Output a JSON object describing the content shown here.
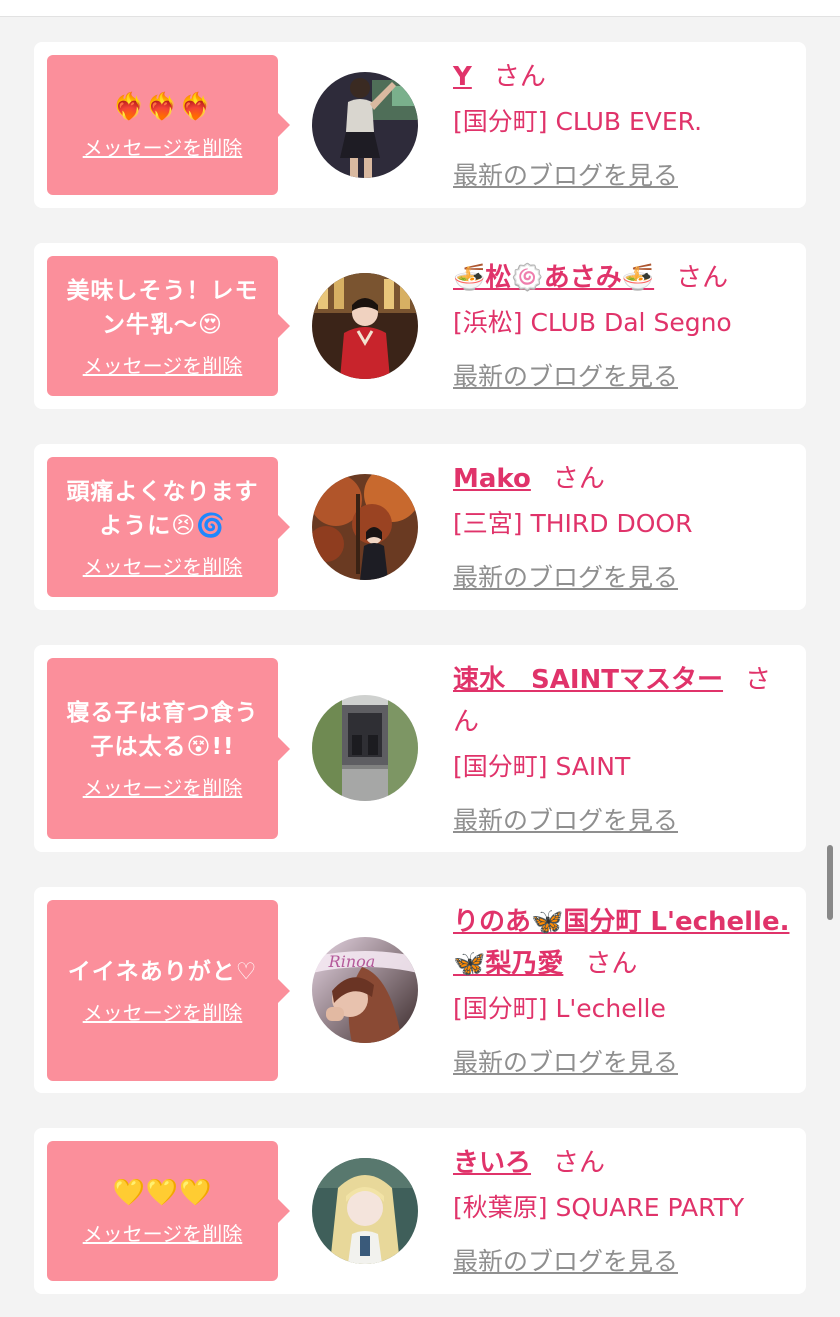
{
  "delete_label": "メッセージを削除",
  "san_label": "さん",
  "blog_label": "最新のブログを見る",
  "colors": {
    "bubble": "#fb8f9b",
    "accent": "#e0336a",
    "muted_link": "#8f8f8f",
    "background": "#f3f3f3"
  },
  "cards": [
    {
      "message": "❤️‍🔥❤️‍🔥❤️‍🔥",
      "name": "Y",
      "shop": "[国分町] CLUB EVER.",
      "avatar": "avatar-photo-dancer"
    },
    {
      "message": "美味しそう！レモン牛乳〜😍",
      "name": "🍜松🍥あさみ🍜",
      "shop": "[浜松] CLUB Dal Segno",
      "avatar": "avatar-photo-kimono"
    },
    {
      "message": "頭痛よくなりますように😣🌀",
      "name": "Mako",
      "shop": "[三宮] THIRD DOOR",
      "avatar": "avatar-photo-autumn"
    },
    {
      "message": "寝る子は育つ食う子は太る😵!!",
      "name": "速水　SAINTマスター",
      "shop": "[国分町] SAINT",
      "avatar": "avatar-photo-room"
    },
    {
      "message": "イイネありがと♡",
      "name": "りのあ🦋国分町 L'echelle.🦋梨乃愛",
      "shop": "[国分町] L'echelle",
      "avatar": "avatar-photo-rinoa",
      "avatar_text": "Rinoa"
    },
    {
      "message": "💛💛💛",
      "name": "きいろ",
      "shop": "[秋葉原] SQUARE PARTY",
      "avatar": "avatar-photo-blonde"
    }
  ]
}
